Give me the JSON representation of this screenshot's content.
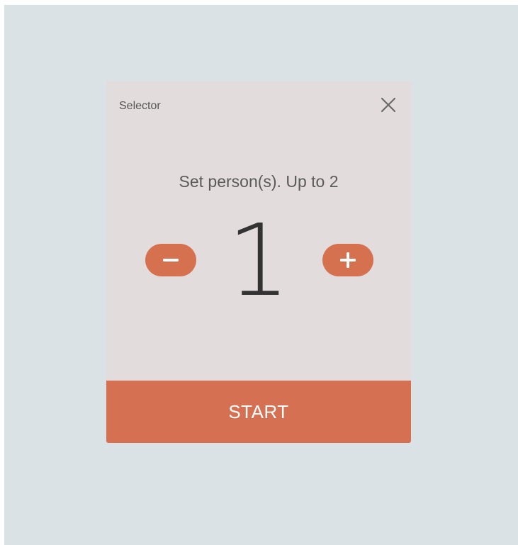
{
  "dialog": {
    "title": "Selector",
    "close_icon": "close-icon",
    "prompt": "Set person(s). Up to 2",
    "count": "1",
    "decrement_icon": "minus-icon",
    "increment_icon": "plus-icon",
    "start_label": "START"
  },
  "colors": {
    "screen_background": "#dbe2e6",
    "dialog_background": "#e2dcdc",
    "accent": "#d57152",
    "count_text": "#333333"
  }
}
